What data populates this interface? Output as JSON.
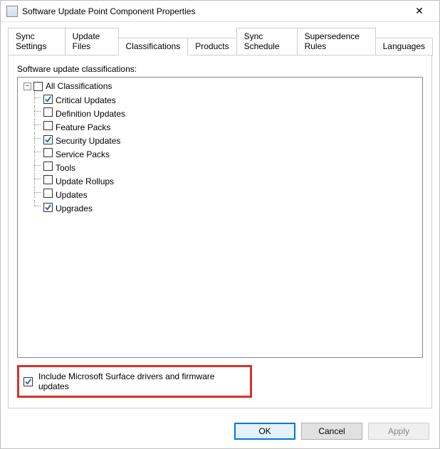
{
  "window": {
    "title": "Software Update Point Component Properties",
    "close_glyph": "✕"
  },
  "tabs": [
    {
      "id": "sync-settings",
      "label": "Sync Settings",
      "active": false
    },
    {
      "id": "update-files",
      "label": "Update Files",
      "active": false
    },
    {
      "id": "classifications",
      "label": "Classifications",
      "active": true
    },
    {
      "id": "products",
      "label": "Products",
      "active": false
    },
    {
      "id": "sync-schedule",
      "label": "Sync Schedule",
      "active": false
    },
    {
      "id": "supersedence-rules",
      "label": "Supersedence Rules",
      "active": false
    },
    {
      "id": "languages",
      "label": "Languages",
      "active": false
    }
  ],
  "section_label": "Software update classifications:",
  "tree": {
    "root": {
      "label": "All Classifications",
      "checked": false,
      "expanded": true,
      "expander_glyph": "−"
    },
    "items": [
      {
        "label": "Critical Updates",
        "checked": true
      },
      {
        "label": "Definition Updates",
        "checked": false
      },
      {
        "label": "Feature Packs",
        "checked": false
      },
      {
        "label": "Security Updates",
        "checked": true
      },
      {
        "label": "Service Packs",
        "checked": false
      },
      {
        "label": "Tools",
        "checked": false
      },
      {
        "label": "Update Rollups",
        "checked": false
      },
      {
        "label": "Updates",
        "checked": false
      },
      {
        "label": "Upgrades",
        "checked": true
      }
    ]
  },
  "surface_option": {
    "label": "Include Microsoft Surface drivers and firmware updates",
    "checked": true
  },
  "buttons": {
    "ok": "OK",
    "cancel": "Cancel",
    "apply": "Apply"
  }
}
